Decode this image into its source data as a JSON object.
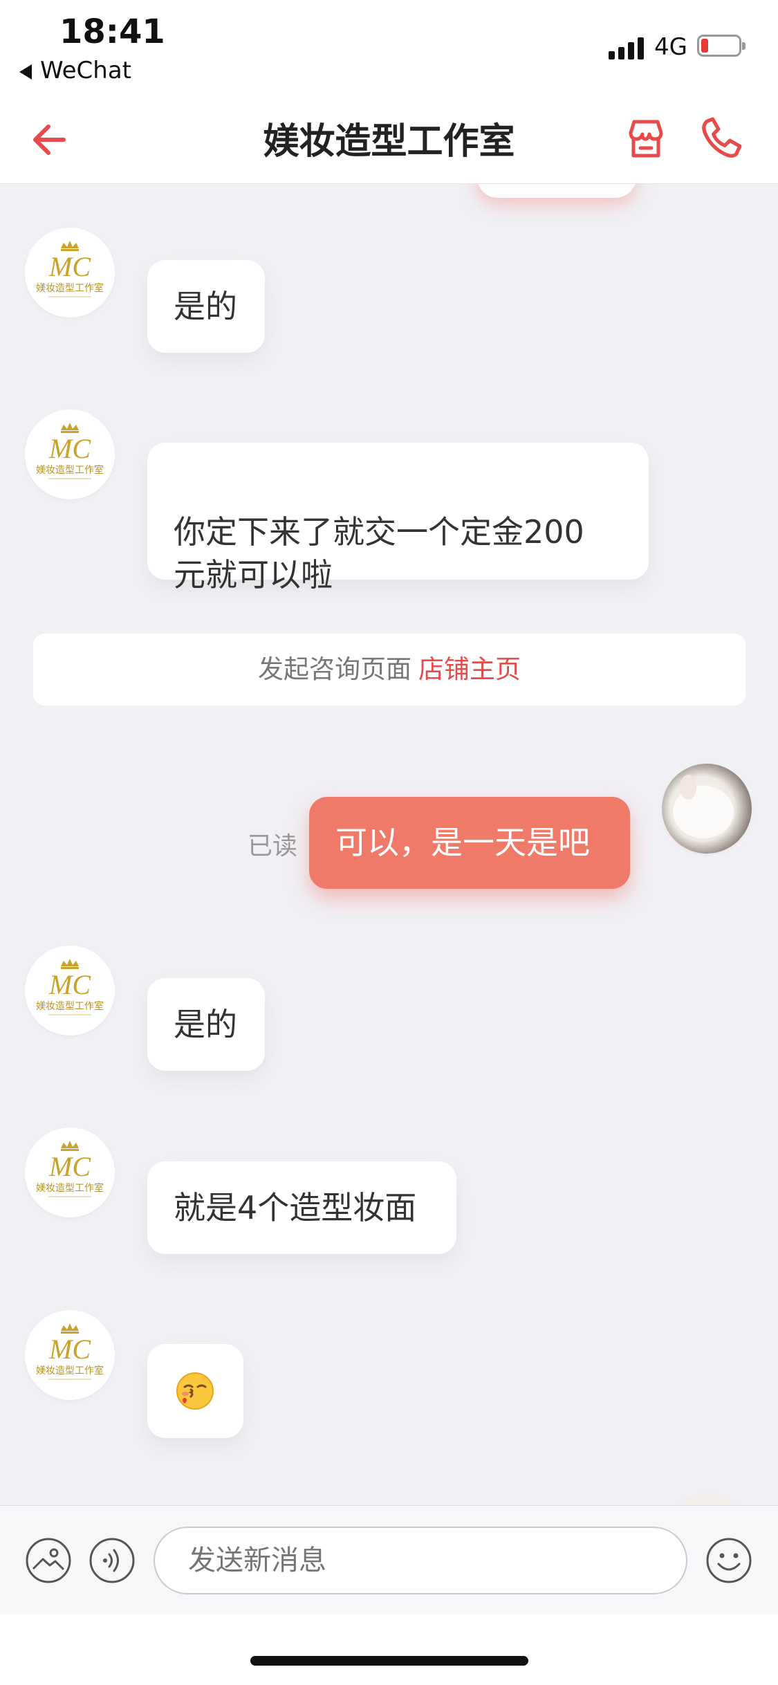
{
  "status_bar": {
    "time": "18:41",
    "back_app": "WeChat",
    "network": "4G"
  },
  "nav": {
    "title": "媄妆造型工作室",
    "back_icon": "back-arrow-icon",
    "store_icon": "store-icon",
    "phone_icon": "phone-icon"
  },
  "colors": {
    "accent": "#e64a4a",
    "outgoing_bubble": "#ef7a6a",
    "background": "#f0f0f5"
  },
  "studio_logo": {
    "caption": "媄妆造型工作室"
  },
  "messages": [
    {
      "direction": "in",
      "text": "是的"
    },
    {
      "direction": "in",
      "text": "你定下来了就交一个定金200\n元就可以啦"
    },
    {
      "direction": "system",
      "text": "发起咨询页面",
      "link": "店铺主页"
    },
    {
      "direction": "out",
      "text": "可以，是一天是吧",
      "status": "已读"
    },
    {
      "direction": "in",
      "text": "是的"
    },
    {
      "direction": "in",
      "text": "就是4个造型妆面"
    },
    {
      "direction": "in",
      "emoji": "kiss-emoji"
    }
  ],
  "input_bar": {
    "placeholder": "发送新消息",
    "image_icon": "image-icon",
    "voice_icon": "voice-icon",
    "emoji_icon": "emoji-face-icon"
  }
}
